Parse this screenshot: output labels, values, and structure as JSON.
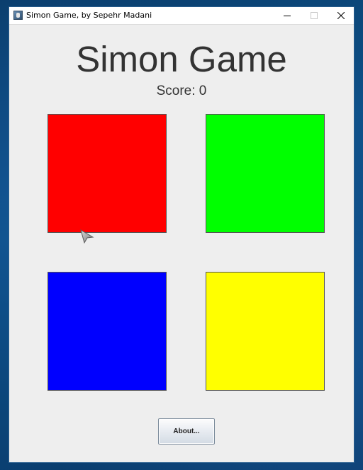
{
  "window": {
    "title": "Simon Game, by Sepehr Madani",
    "icon": "app-icon",
    "controls": [
      "minimize-icon",
      "maximize-icon",
      "close-icon"
    ]
  },
  "game": {
    "title": "Simon Game",
    "score_text": "Score: 0",
    "score": 0,
    "pads": [
      {
        "name": "red",
        "color": "#ff0000"
      },
      {
        "name": "green",
        "color": "#00ff00"
      },
      {
        "name": "blue",
        "color": "#0000ff"
      },
      {
        "name": "yellow",
        "color": "#ffff00"
      }
    ]
  },
  "footer": {
    "about_label": "About..."
  }
}
